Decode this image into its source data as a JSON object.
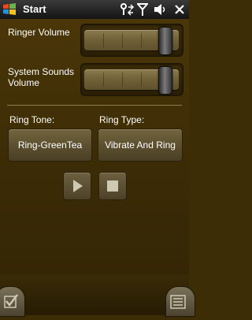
{
  "titlebar": {
    "title": "Start"
  },
  "icons": {
    "start": "windows-flag-icon",
    "connectivity": "connectivity-icon",
    "signal": "signal-antenna-icon",
    "volume": "speaker-icon",
    "close": "close-icon",
    "play": "play-icon",
    "stop": "stop-icon",
    "ok": "checkmark-icon",
    "menu": "menu-list-icon"
  },
  "ringer": {
    "label": "Ringer Volume",
    "level": 0.9
  },
  "system_sounds": {
    "label": "System Sounds Volume",
    "label_line1": "System Sounds",
    "label_line2": "Volume",
    "level": 0.9
  },
  "ring_tone": {
    "label": "Ring Tone:",
    "value": "Ring-GreenTea"
  },
  "ring_type": {
    "label": "Ring Type:",
    "value": "Vibrate And Ring"
  },
  "colors": {
    "background": "#3d2d07",
    "button": "#5d5030",
    "track": "#6f6037"
  }
}
